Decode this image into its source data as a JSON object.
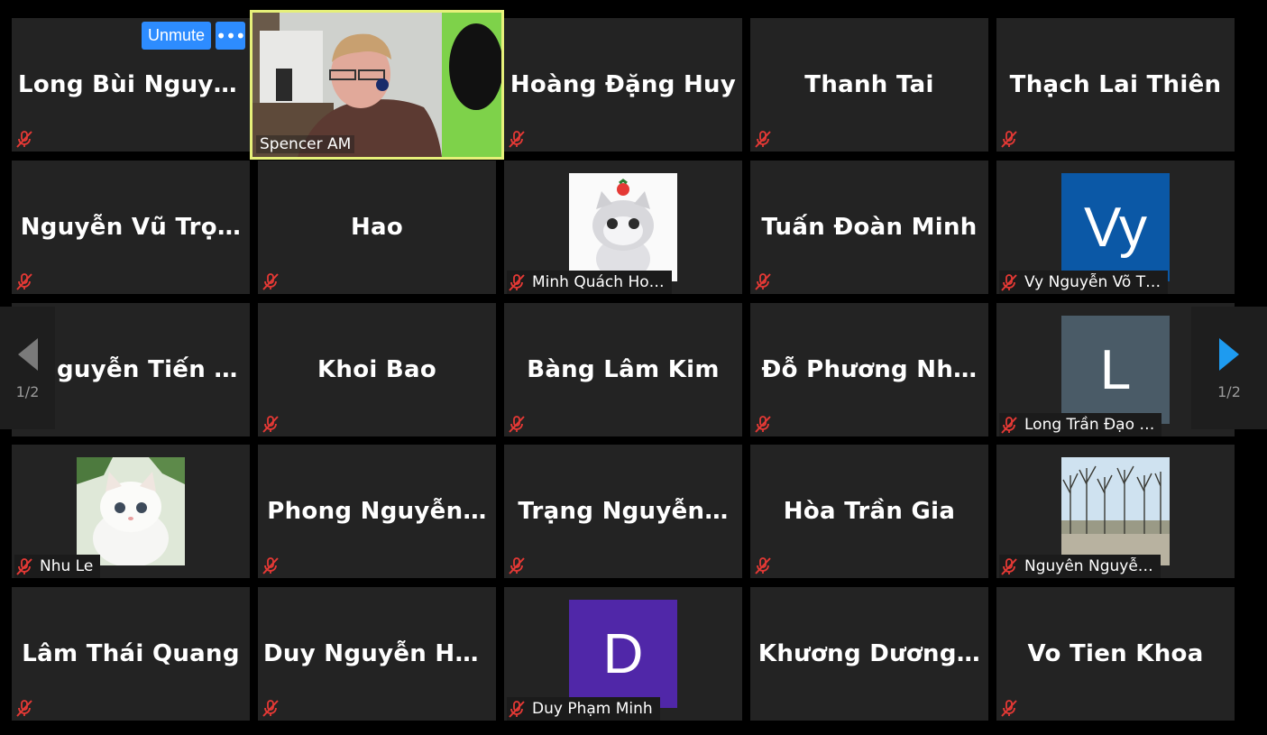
{
  "controls": {
    "unmute_label": "Unmute",
    "more_label": "•••"
  },
  "pagination": {
    "left_page": "1/2",
    "right_page": "1/2"
  },
  "active_speaker": {
    "name": "Spencer AM"
  },
  "tiles": [
    {
      "name": "Long  Bùi  Nguyễ…"
    },
    {
      "name": "Spencer AM"
    },
    {
      "name": "Hoàng Đặng Huy"
    },
    {
      "name": "Thanh Tai"
    },
    {
      "name": "Thạch Lai Thiên"
    },
    {
      "name": "Nguyễn  Vũ  Trọ…"
    },
    {
      "name": "Hao"
    },
    {
      "name": "Minh Quách Ho…"
    },
    {
      "name": "Tuấn Đoàn Minh"
    },
    {
      "name": "Vy Nguyễn Võ T…",
      "avatar": "Vy",
      "avatar_color": "#0b58a6"
    },
    {
      "name": "guyễn  Tiến  Th…"
    },
    {
      "name": "Khoi Bao"
    },
    {
      "name": "Bàng Lâm Kim"
    },
    {
      "name": "Đỗ  Phương  Nh…"
    },
    {
      "name": "Long Trần Đạo …",
      "avatar": "L",
      "avatar_color": "#4a5b67"
    },
    {
      "name": "Nhu Le"
    },
    {
      "name": "Phong  Nguyễn…"
    },
    {
      "name": "Trạng  Nguyễn…"
    },
    {
      "name": "Hòa Trần Gia"
    },
    {
      "name": "Nguyên Nguyễ…"
    },
    {
      "name": "Lâm Thái Quang"
    },
    {
      "name": "Duy  Nguyễn  Ho…"
    },
    {
      "name": "Duy Phạm Minh",
      "avatar": "D",
      "avatar_color": "#5027a8"
    },
    {
      "name": "Khương  Dương…"
    },
    {
      "name": "Vo Tien Khoa"
    }
  ]
}
